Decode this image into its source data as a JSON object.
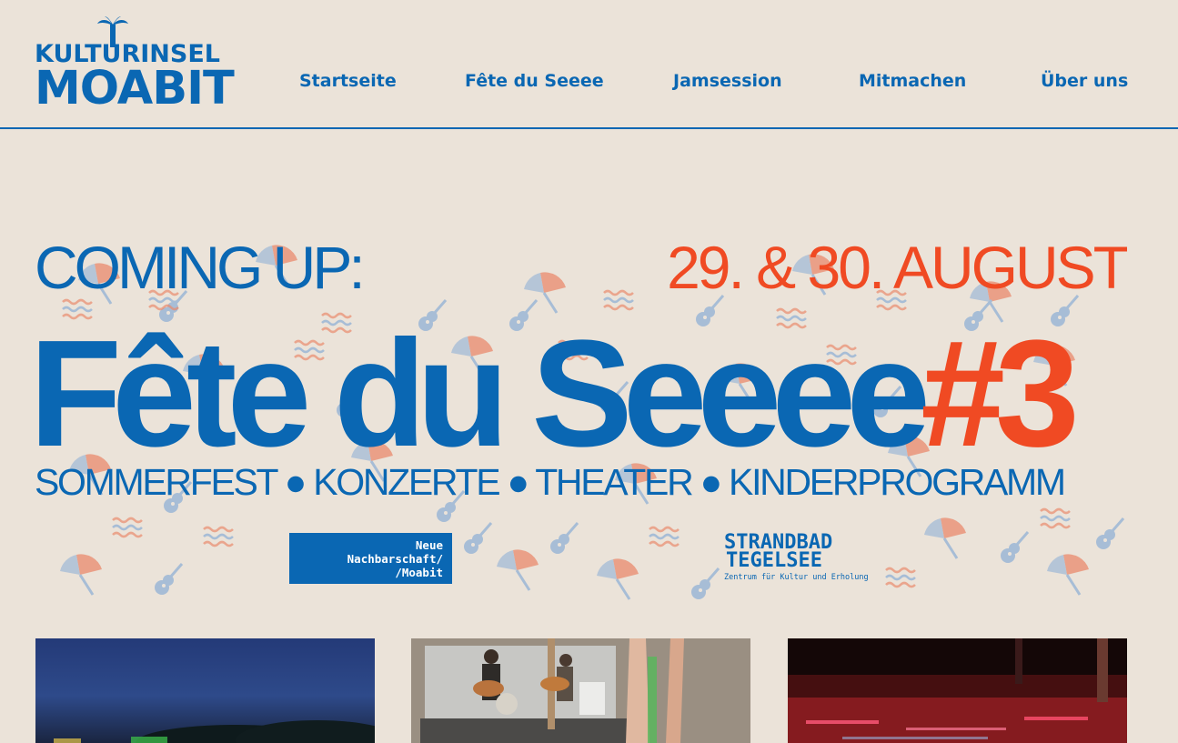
{
  "header": {
    "logo_top": "KULTURINSEL",
    "logo_bottom": "MOABIT",
    "nav": [
      {
        "label": "Startseite"
      },
      {
        "label": "Fête du Seeee"
      },
      {
        "label": "Jamsession"
      },
      {
        "label": "Mitmachen"
      },
      {
        "label": "Über uns"
      }
    ]
  },
  "banner": {
    "coming_up": "COMING UP:",
    "date": "29. & 30. AUGUST",
    "title": "Fête du Seeee",
    "title_number": "#3",
    "subtitle": "SOMMERFEST ● KONZERTE ● THEATER ● KINDERPROGRAMM",
    "partner1": [
      "Neue",
      "Nachbarschaft/",
      "/Moabit"
    ],
    "partner2": [
      "STRANDBAD",
      "TEGELSEE",
      "Zentrum für Kultur und Erholung"
    ]
  },
  "colors": {
    "background": "#ebe3d9",
    "primary_blue": "#0a67b3",
    "accent_orange": "#f04a23"
  },
  "icons": [
    "palm-icon",
    "umbrella-icon",
    "guitar-icon",
    "waves-icon"
  ]
}
